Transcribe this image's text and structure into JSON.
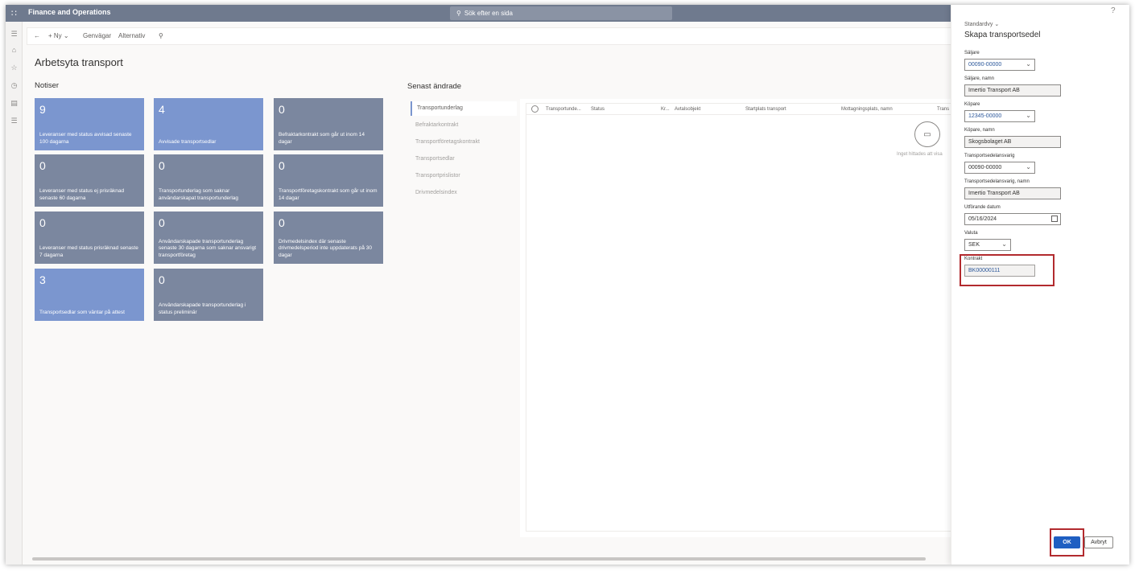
{
  "app": {
    "title": "Finance and Operations",
    "search_placeholder": "Sök efter en sida"
  },
  "actionbar": {
    "new_label": "Ny",
    "shortcuts_label": "Genvägar",
    "options_label": "Alternativ"
  },
  "page": {
    "title": "Arbetsyta transport",
    "notices_header": "Notiser",
    "recent_header": "Senast ändrade"
  },
  "tiles": [
    {
      "count": "9",
      "label": "Leveranser med status avvisad senaste 100 dagarna"
    },
    {
      "count": "4",
      "label": "Avvisade transportsedlar"
    },
    {
      "count": "0",
      "label": "Befraktarkontrakt som går ut inom 14 dagar"
    },
    {
      "count": "0",
      "label": "Leveranser med status ej prisräknad senaste 60 dagarna"
    },
    {
      "count": "0",
      "label": "Transportunderlag som saknar användarskapat transportunderlag"
    },
    {
      "count": "0",
      "label": "Transportföretagskontrakt som går ut inom 14 dagar"
    },
    {
      "count": "0",
      "label": "Leveranser med status prisräknad senaste 7 dagarna"
    },
    {
      "count": "0",
      "label": "Användarskapade transportunderlag senaste 30 dagarna som saknar ansvarigt transportföretag"
    },
    {
      "count": "0",
      "label": "Drivmedelsindex där senaste drivmedelsperiod inte uppdaterats på 30 dagar"
    },
    {
      "count": "3",
      "label": "Transportsedlar som väntar på attest"
    },
    {
      "count": "0",
      "label": "Användarskapade transportunderlag i status preliminär"
    }
  ],
  "recent_tabs": [
    "Transportunderlag",
    "Befraktarkontrakt",
    "Transportföretagskontrakt",
    "Transportsedlar",
    "Transportprislistor",
    "Drivmedelsindex"
  ],
  "grid": {
    "columns": [
      "Transportunde...",
      "Status",
      "Kr...",
      "Avtalsobjekt",
      "Startplats transport",
      "Mottagningsplats, namn",
      "Trans"
    ],
    "empty_text": "Inget hittades att visa"
  },
  "panel": {
    "help": "?",
    "view_label": "Standardvy",
    "title": "Skapa transportsedel",
    "fields": {
      "seller_label": "Säljare",
      "seller_value": "00090-00000",
      "seller_name_label": "Säljare, namn",
      "seller_name_value": "Imertio Transport AB",
      "buyer_label": "Köpare",
      "buyer_value": "12345-00000",
      "buyer_name_label": "Köpare, namn",
      "buyer_name_value": "Skogsbolaget AB",
      "resp_label": "Transportsedelansvarig",
      "resp_value": "00090-00000",
      "resp_name_label": "Transportsedelansvarig, namn",
      "resp_name_value": "Imertio Transport AB",
      "date_label": "Utförande datum",
      "date_value": "05/16/2024",
      "currency_label": "Valuta",
      "currency_value": "SEK",
      "contract_label": "Kontrakt",
      "contract_value": "BK00000111"
    },
    "ok_label": "OK",
    "cancel_label": "Avbryt"
  }
}
